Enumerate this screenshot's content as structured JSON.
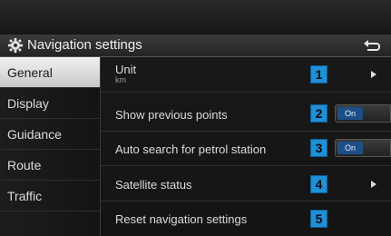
{
  "header": {
    "title": "Navigation settings",
    "icon": "gear-icon",
    "back_icon": "back-icon"
  },
  "sidebar": {
    "items": [
      {
        "label": "General",
        "active": true
      },
      {
        "label": "Display",
        "active": false
      },
      {
        "label": "Guidance",
        "active": false
      },
      {
        "label": "Route",
        "active": false
      },
      {
        "label": "Traffic",
        "active": false
      }
    ]
  },
  "settings": [
    {
      "label": "Unit",
      "value": "km",
      "badge": "1",
      "control": "arrow"
    },
    {
      "label": "Show previous points",
      "badge": "2",
      "control": "toggle",
      "state": "On"
    },
    {
      "label": "Auto search for petrol station",
      "badge": "3",
      "control": "toggle",
      "state": "On"
    },
    {
      "label": "Satellite status",
      "badge": "4",
      "control": "arrow"
    },
    {
      "label": "Reset navigation settings",
      "badge": "5",
      "control": "none"
    }
  ],
  "colors": {
    "accent": "#1f8fd6",
    "toggle_on": "#1d4f86",
    "active_tab": "#e0e0e0"
  }
}
